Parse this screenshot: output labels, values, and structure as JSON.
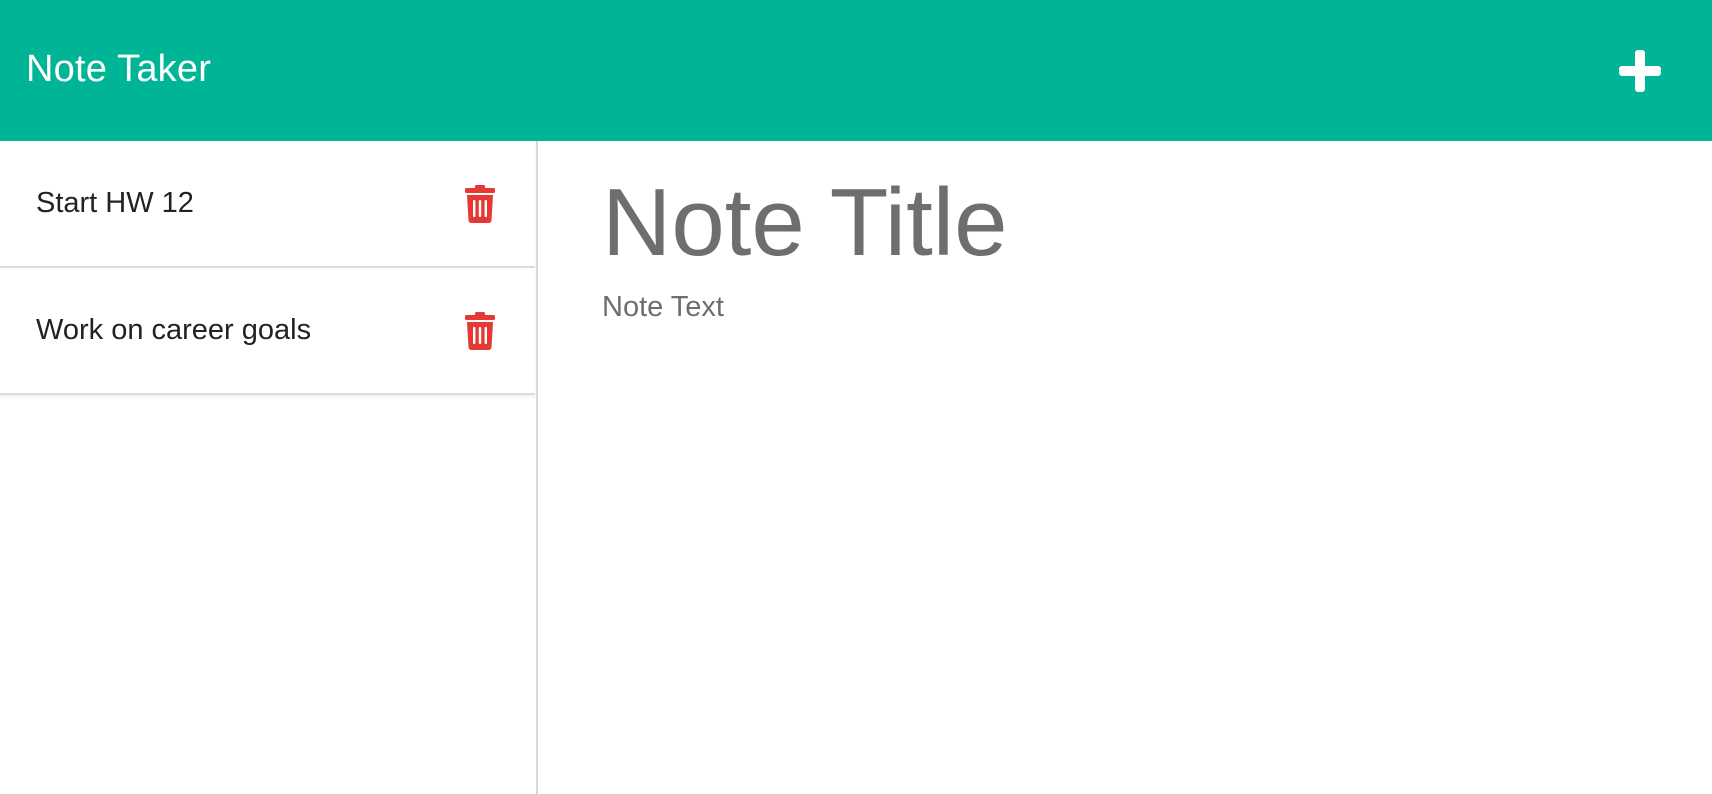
{
  "navbar": {
    "brand": "Note Taker",
    "add_icon": "plus-icon",
    "bg_color": "#00b595"
  },
  "sidebar": {
    "notes": [
      {
        "label": "Start HW 12",
        "delete_icon": "trash-icon"
      },
      {
        "label": "Work on career goals",
        "delete_icon": "trash-icon"
      }
    ],
    "delete_icon_color": "#e53935"
  },
  "editor": {
    "title_placeholder": "Note Title",
    "title_value": "",
    "text_placeholder": "Note Text",
    "text_value": ""
  }
}
